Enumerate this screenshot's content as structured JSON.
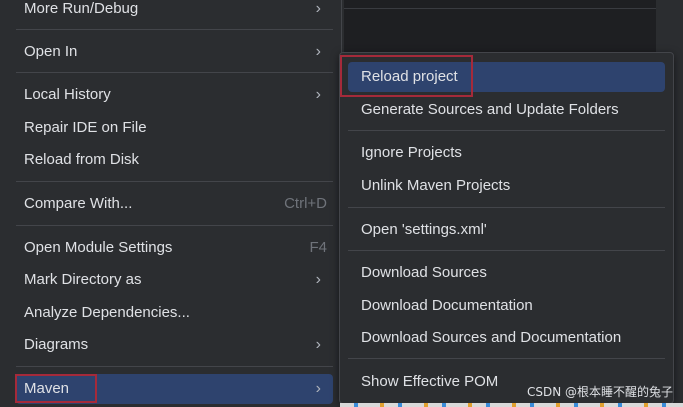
{
  "left_menu": {
    "items": [
      {
        "label": "More Run/Debug",
        "has_submenu": true
      },
      {
        "label": "Open In",
        "has_submenu": true
      },
      {
        "label": "Local History",
        "has_submenu": true
      },
      {
        "label": "Repair IDE on File"
      },
      {
        "label": "Reload from Disk"
      },
      {
        "label": "Compare With...",
        "shortcut": "Ctrl+D"
      },
      {
        "label": "Open Module Settings",
        "shortcut": "F4"
      },
      {
        "label": "Mark Directory as",
        "has_submenu": true
      },
      {
        "label": "Analyze Dependencies..."
      },
      {
        "label": "Diagrams",
        "has_submenu": true
      },
      {
        "label": "Maven",
        "has_submenu": true,
        "selected": true
      }
    ],
    "chevron": "›"
  },
  "maven_submenu": {
    "items": [
      {
        "label": "Reload project",
        "selected": true
      },
      {
        "label": "Generate Sources and Update Folders"
      },
      {
        "label": "Ignore Projects"
      },
      {
        "label": "Unlink Maven Projects"
      },
      {
        "label": "Open 'settings.xml'"
      },
      {
        "label": "Download Sources"
      },
      {
        "label": "Download Documentation"
      },
      {
        "label": "Download Sources and Documentation"
      },
      {
        "label": "Show Effective POM"
      }
    ]
  },
  "watermark": "CSDN @根本睡不醒的兔子",
  "colors": {
    "selection": "#2e436e",
    "highlight_box": "#a52a3a",
    "menu_bg": "#2b2d30"
  }
}
